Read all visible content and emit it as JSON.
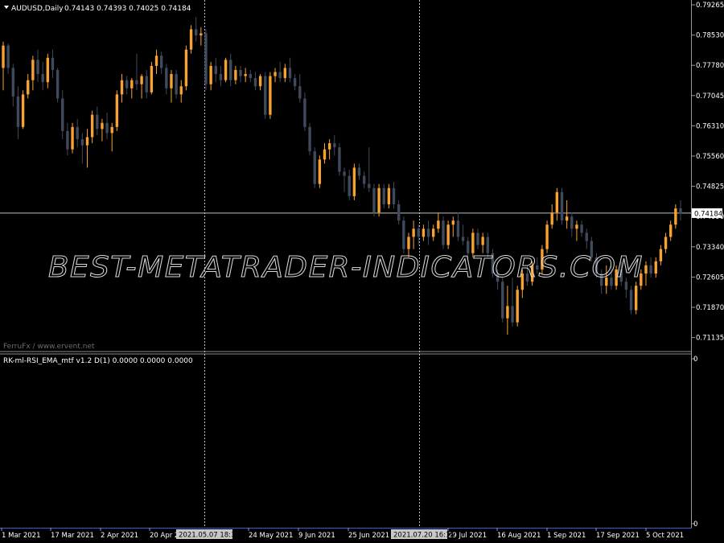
{
  "main_window": {
    "symbol_label": "AUDUSD,Daily",
    "ohlc_label": "0.74143 0.74393 0.74025 0.74184",
    "watermark_text": "BEST-METATRADER-INDICATORS.COM",
    "credit_text": "FerruFx / www.ervent.net"
  },
  "indicator_window": {
    "label": "RK-ml-RSI_EMA_mtf v1.2 D(1) 0.0000 0.0000 0.0000",
    "scale_top": "0",
    "scale_bottom": "0"
  },
  "price_axis": {
    "ticks": [
      "0.79265",
      "0.78530",
      "0.77780",
      "0.77045",
      "0.76310",
      "0.75560",
      "0.74825",
      "0.74090",
      "0.73340",
      "0.72605",
      "0.71870",
      "0.71135"
    ],
    "current_price": "0.74184"
  },
  "time_axis": {
    "labels": [
      "1 Mar 2021",
      "17 Mar 2021",
      "2 Apr 2021",
      "20 Apr 2021",
      "24 May 2021",
      "9 Jun 2021",
      "25 Jun 2021",
      "29 Jul 2021",
      "16 Aug 2021",
      "1 Sep 2021",
      "17 Sep 2021",
      "5 Oct 2021"
    ],
    "highlights": [
      "2021.05.07 18:30",
      "2021.07.20 16:15"
    ]
  },
  "colors": {
    "background": "#000000",
    "bull": "#f7a233",
    "bear": "#3f4a5c",
    "text": "#ffffff",
    "grid_line": "#bfbfbf",
    "separator": "#8c8c8c",
    "axis_blue": "#3d5dd6"
  },
  "chart_data": {
    "type": "candlestick",
    "symbol": "AUDUSD",
    "timeframe": "Daily",
    "ylim": [
      0.7106,
      0.7934
    ],
    "current_price": 0.74184,
    "candles": [
      {
        "o": 0.7775,
        "h": 0.784,
        "l": 0.772,
        "c": 0.783
      },
      {
        "o": 0.783,
        "h": 0.7835,
        "l": 0.776,
        "c": 0.7775
      },
      {
        "o": 0.7775,
        "h": 0.7785,
        "l": 0.768,
        "c": 0.7705
      },
      {
        "o": 0.7705,
        "h": 0.773,
        "l": 0.76,
        "c": 0.763
      },
      {
        "o": 0.763,
        "h": 0.772,
        "l": 0.7625,
        "c": 0.771
      },
      {
        "o": 0.771,
        "h": 0.776,
        "l": 0.77,
        "c": 0.7745
      },
      {
        "o": 0.7745,
        "h": 0.7805,
        "l": 0.772,
        "c": 0.7795
      },
      {
        "o": 0.7795,
        "h": 0.782,
        "l": 0.774,
        "c": 0.776
      },
      {
        "o": 0.776,
        "h": 0.779,
        "l": 0.772,
        "c": 0.774
      },
      {
        "o": 0.774,
        "h": 0.781,
        "l": 0.7725,
        "c": 0.78
      },
      {
        "o": 0.78,
        "h": 0.782,
        "l": 0.775,
        "c": 0.777
      },
      {
        "o": 0.777,
        "h": 0.7775,
        "l": 0.769,
        "c": 0.77
      },
      {
        "o": 0.77,
        "h": 0.772,
        "l": 0.76,
        "c": 0.762
      },
      {
        "o": 0.762,
        "h": 0.764,
        "l": 0.756,
        "c": 0.7575
      },
      {
        "o": 0.7575,
        "h": 0.764,
        "l": 0.7565,
        "c": 0.763
      },
      {
        "o": 0.763,
        "h": 0.765,
        "l": 0.758,
        "c": 0.76
      },
      {
        "o": 0.76,
        "h": 0.7615,
        "l": 0.754,
        "c": 0.7585
      },
      {
        "o": 0.7585,
        "h": 0.7625,
        "l": 0.753,
        "c": 0.7605
      },
      {
        "o": 0.7605,
        "h": 0.767,
        "l": 0.759,
        "c": 0.766
      },
      {
        "o": 0.766,
        "h": 0.768,
        "l": 0.761,
        "c": 0.7625
      },
      {
        "o": 0.7625,
        "h": 0.765,
        "l": 0.7595,
        "c": 0.764
      },
      {
        "o": 0.764,
        "h": 0.7665,
        "l": 0.76,
        "c": 0.7615
      },
      {
        "o": 0.7615,
        "h": 0.764,
        "l": 0.757,
        "c": 0.763
      },
      {
        "o": 0.763,
        "h": 0.772,
        "l": 0.762,
        "c": 0.771
      },
      {
        "o": 0.771,
        "h": 0.776,
        "l": 0.769,
        "c": 0.7745
      },
      {
        "o": 0.7745,
        "h": 0.7755,
        "l": 0.771,
        "c": 0.7725
      },
      {
        "o": 0.7725,
        "h": 0.775,
        "l": 0.77,
        "c": 0.7745
      },
      {
        "o": 0.7745,
        "h": 0.781,
        "l": 0.772,
        "c": 0.7735
      },
      {
        "o": 0.7735,
        "h": 0.776,
        "l": 0.77,
        "c": 0.7755
      },
      {
        "o": 0.7755,
        "h": 0.777,
        "l": 0.77,
        "c": 0.7715
      },
      {
        "o": 0.7715,
        "h": 0.779,
        "l": 0.771,
        "c": 0.778
      },
      {
        "o": 0.778,
        "h": 0.782,
        "l": 0.776,
        "c": 0.7805
      },
      {
        "o": 0.7805,
        "h": 0.7815,
        "l": 0.776,
        "c": 0.7775
      },
      {
        "o": 0.7775,
        "h": 0.7785,
        "l": 0.771,
        "c": 0.7725
      },
      {
        "o": 0.7725,
        "h": 0.777,
        "l": 0.769,
        "c": 0.776
      },
      {
        "o": 0.776,
        "h": 0.777,
        "l": 0.77,
        "c": 0.771
      },
      {
        "o": 0.771,
        "h": 0.7745,
        "l": 0.769,
        "c": 0.773
      },
      {
        "o": 0.773,
        "h": 0.783,
        "l": 0.772,
        "c": 0.782
      },
      {
        "o": 0.782,
        "h": 0.788,
        "l": 0.781,
        "c": 0.787
      },
      {
        "o": 0.787,
        "h": 0.79,
        "l": 0.784,
        "c": 0.7855
      },
      {
        "o": 0.7855,
        "h": 0.7875,
        "l": 0.783,
        "c": 0.786
      },
      {
        "o": 0.786,
        "h": 0.787,
        "l": 0.772,
        "c": 0.7735
      },
      {
        "o": 0.7735,
        "h": 0.779,
        "l": 0.772,
        "c": 0.778
      },
      {
        "o": 0.778,
        "h": 0.78,
        "l": 0.774,
        "c": 0.776
      },
      {
        "o": 0.776,
        "h": 0.778,
        "l": 0.773,
        "c": 0.7745
      },
      {
        "o": 0.7745,
        "h": 0.78,
        "l": 0.774,
        "c": 0.7795
      },
      {
        "o": 0.7795,
        "h": 0.781,
        "l": 0.773,
        "c": 0.7745
      },
      {
        "o": 0.7745,
        "h": 0.778,
        "l": 0.7735,
        "c": 0.777
      },
      {
        "o": 0.777,
        "h": 0.778,
        "l": 0.774,
        "c": 0.7755
      },
      {
        "o": 0.7755,
        "h": 0.7775,
        "l": 0.774,
        "c": 0.776
      },
      {
        "o": 0.776,
        "h": 0.777,
        "l": 0.774,
        "c": 0.775
      },
      {
        "o": 0.775,
        "h": 0.7765,
        "l": 0.772,
        "c": 0.773
      },
      {
        "o": 0.773,
        "h": 0.776,
        "l": 0.772,
        "c": 0.7755
      },
      {
        "o": 0.7755,
        "h": 0.7765,
        "l": 0.765,
        "c": 0.766
      },
      {
        "o": 0.766,
        "h": 0.7765,
        "l": 0.765,
        "c": 0.7755
      },
      {
        "o": 0.7755,
        "h": 0.7775,
        "l": 0.774,
        "c": 0.7765
      },
      {
        "o": 0.7765,
        "h": 0.779,
        "l": 0.774,
        "c": 0.775
      },
      {
        "o": 0.775,
        "h": 0.7785,
        "l": 0.774,
        "c": 0.7775
      },
      {
        "o": 0.7775,
        "h": 0.78,
        "l": 0.774,
        "c": 0.775
      },
      {
        "o": 0.775,
        "h": 0.776,
        "l": 0.772,
        "c": 0.773
      },
      {
        "o": 0.773,
        "h": 0.776,
        "l": 0.769,
        "c": 0.77
      },
      {
        "o": 0.77,
        "h": 0.7715,
        "l": 0.762,
        "c": 0.763
      },
      {
        "o": 0.763,
        "h": 0.764,
        "l": 0.756,
        "c": 0.757
      },
      {
        "o": 0.757,
        "h": 0.758,
        "l": 0.748,
        "c": 0.749
      },
      {
        "o": 0.749,
        "h": 0.756,
        "l": 0.748,
        "c": 0.755
      },
      {
        "o": 0.755,
        "h": 0.759,
        "l": 0.754,
        "c": 0.7575
      },
      {
        "o": 0.7575,
        "h": 0.76,
        "l": 0.755,
        "c": 0.759
      },
      {
        "o": 0.759,
        "h": 0.761,
        "l": 0.756,
        "c": 0.758
      },
      {
        "o": 0.758,
        "h": 0.759,
        "l": 0.751,
        "c": 0.752
      },
      {
        "o": 0.752,
        "h": 0.753,
        "l": 0.747,
        "c": 0.751
      },
      {
        "o": 0.751,
        "h": 0.7525,
        "l": 0.745,
        "c": 0.746
      },
      {
        "o": 0.746,
        "h": 0.754,
        "l": 0.745,
        "c": 0.753
      },
      {
        "o": 0.753,
        "h": 0.754,
        "l": 0.75,
        "c": 0.751
      },
      {
        "o": 0.751,
        "h": 0.752,
        "l": 0.748,
        "c": 0.749
      },
      {
        "o": 0.749,
        "h": 0.758,
        "l": 0.747,
        "c": 0.748
      },
      {
        "o": 0.748,
        "h": 0.749,
        "l": 0.741,
        "c": 0.742
      },
      {
        "o": 0.742,
        "h": 0.749,
        "l": 0.741,
        "c": 0.748
      },
      {
        "o": 0.748,
        "h": 0.749,
        "l": 0.743,
        "c": 0.744
      },
      {
        "o": 0.744,
        "h": 0.749,
        "l": 0.743,
        "c": 0.748
      },
      {
        "o": 0.748,
        "h": 0.7495,
        "l": 0.743,
        "c": 0.744
      },
      {
        "o": 0.744,
        "h": 0.745,
        "l": 0.739,
        "c": 0.74
      },
      {
        "o": 0.74,
        "h": 0.741,
        "l": 0.732,
        "c": 0.733
      },
      {
        "o": 0.733,
        "h": 0.737,
        "l": 0.731,
        "c": 0.736
      },
      {
        "o": 0.736,
        "h": 0.74,
        "l": 0.733,
        "c": 0.738
      },
      {
        "o": 0.738,
        "h": 0.739,
        "l": 0.734,
        "c": 0.736
      },
      {
        "o": 0.736,
        "h": 0.739,
        "l": 0.735,
        "c": 0.738
      },
      {
        "o": 0.738,
        "h": 0.74,
        "l": 0.734,
        "c": 0.736
      },
      {
        "o": 0.736,
        "h": 0.739,
        "l": 0.735,
        "c": 0.738
      },
      {
        "o": 0.738,
        "h": 0.742,
        "l": 0.737,
        "c": 0.74
      },
      {
        "o": 0.74,
        "h": 0.741,
        "l": 0.733,
        "c": 0.734
      },
      {
        "o": 0.734,
        "h": 0.74,
        "l": 0.733,
        "c": 0.739
      },
      {
        "o": 0.739,
        "h": 0.741,
        "l": 0.736,
        "c": 0.74
      },
      {
        "o": 0.74,
        "h": 0.742,
        "l": 0.735,
        "c": 0.736
      },
      {
        "o": 0.736,
        "h": 0.739,
        "l": 0.734,
        "c": 0.735
      },
      {
        "o": 0.735,
        "h": 0.736,
        "l": 0.73,
        "c": 0.732
      },
      {
        "o": 0.732,
        "h": 0.738,
        "l": 0.731,
        "c": 0.737
      },
      {
        "o": 0.737,
        "h": 0.738,
        "l": 0.733,
        "c": 0.734
      },
      {
        "o": 0.734,
        "h": 0.737,
        "l": 0.732,
        "c": 0.736
      },
      {
        "o": 0.736,
        "h": 0.737,
        "l": 0.731,
        "c": 0.732
      },
      {
        "o": 0.732,
        "h": 0.733,
        "l": 0.726,
        "c": 0.727
      },
      {
        "o": 0.727,
        "h": 0.728,
        "l": 0.723,
        "c": 0.725
      },
      {
        "o": 0.725,
        "h": 0.726,
        "l": 0.715,
        "c": 0.716
      },
      {
        "o": 0.716,
        "h": 0.724,
        "l": 0.712,
        "c": 0.719
      },
      {
        "o": 0.719,
        "h": 0.726,
        "l": 0.714,
        "c": 0.715
      },
      {
        "o": 0.715,
        "h": 0.724,
        "l": 0.714,
        "c": 0.723
      },
      {
        "o": 0.723,
        "h": 0.728,
        "l": 0.721,
        "c": 0.727
      },
      {
        "o": 0.727,
        "h": 0.729,
        "l": 0.724,
        "c": 0.725
      },
      {
        "o": 0.725,
        "h": 0.73,
        "l": 0.724,
        "c": 0.729
      },
      {
        "o": 0.729,
        "h": 0.731,
        "l": 0.727,
        "c": 0.728
      },
      {
        "o": 0.728,
        "h": 0.734,
        "l": 0.727,
        "c": 0.733
      },
      {
        "o": 0.733,
        "h": 0.74,
        "l": 0.732,
        "c": 0.739
      },
      {
        "o": 0.739,
        "h": 0.744,
        "l": 0.738,
        "c": 0.742
      },
      {
        "o": 0.742,
        "h": 0.748,
        "l": 0.74,
        "c": 0.747
      },
      {
        "o": 0.747,
        "h": 0.748,
        "l": 0.739,
        "c": 0.74
      },
      {
        "o": 0.74,
        "h": 0.745,
        "l": 0.738,
        "c": 0.741
      },
      {
        "o": 0.741,
        "h": 0.742,
        "l": 0.736,
        "c": 0.738
      },
      {
        "o": 0.738,
        "h": 0.74,
        "l": 0.735,
        "c": 0.739
      },
      {
        "o": 0.739,
        "h": 0.74,
        "l": 0.736,
        "c": 0.737
      },
      {
        "o": 0.737,
        "h": 0.738,
        "l": 0.733,
        "c": 0.735
      },
      {
        "o": 0.735,
        "h": 0.736,
        "l": 0.73,
        "c": 0.731
      },
      {
        "o": 0.731,
        "h": 0.732,
        "l": 0.726,
        "c": 0.727
      },
      {
        "o": 0.727,
        "h": 0.728,
        "l": 0.722,
        "c": 0.724
      },
      {
        "o": 0.724,
        "h": 0.729,
        "l": 0.722,
        "c": 0.726
      },
      {
        "o": 0.726,
        "h": 0.729,
        "l": 0.723,
        "c": 0.724
      },
      {
        "o": 0.724,
        "h": 0.729,
        "l": 0.723,
        "c": 0.728
      },
      {
        "o": 0.728,
        "h": 0.73,
        "l": 0.724,
        "c": 0.725
      },
      {
        "o": 0.725,
        "h": 0.726,
        "l": 0.721,
        "c": 0.723
      },
      {
        "o": 0.723,
        "h": 0.724,
        "l": 0.717,
        "c": 0.718
      },
      {
        "o": 0.718,
        "h": 0.725,
        "l": 0.717,
        "c": 0.724
      },
      {
        "o": 0.724,
        "h": 0.728,
        "l": 0.723,
        "c": 0.727
      },
      {
        "o": 0.727,
        "h": 0.73,
        "l": 0.724,
        "c": 0.729
      },
      {
        "o": 0.729,
        "h": 0.731,
        "l": 0.726,
        "c": 0.727
      },
      {
        "o": 0.727,
        "h": 0.731,
        "l": 0.726,
        "c": 0.73
      },
      {
        "o": 0.73,
        "h": 0.734,
        "l": 0.729,
        "c": 0.733
      },
      {
        "o": 0.733,
        "h": 0.737,
        "l": 0.732,
        "c": 0.736
      },
      {
        "o": 0.736,
        "h": 0.74,
        "l": 0.735,
        "c": 0.739
      },
      {
        "o": 0.739,
        "h": 0.744,
        "l": 0.738,
        "c": 0.743
      },
      {
        "o": 0.743,
        "h": 0.745,
        "l": 0.74,
        "c": 0.7418
      }
    ]
  }
}
